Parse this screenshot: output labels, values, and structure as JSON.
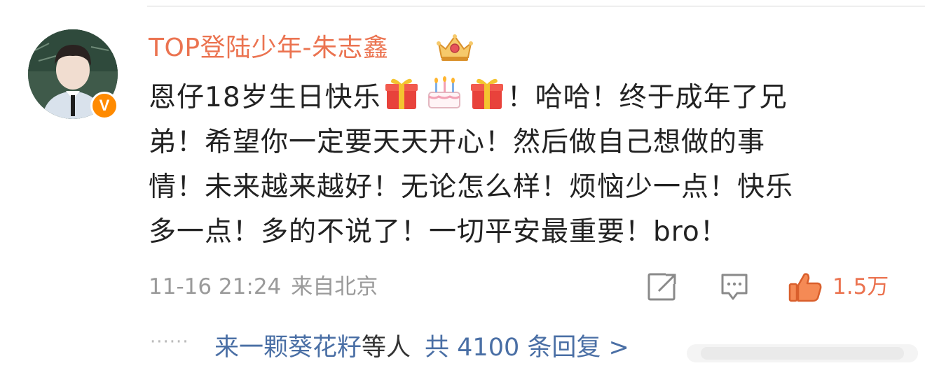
{
  "post": {
    "username": "TOP登陆少年-朱志鑫",
    "verified_badge": "V",
    "content_lines": [
      {
        "pre": "恩仔18岁生日快乐",
        "post": "！哈哈！终于成年了兄"
      },
      {
        "text": "弟！希望你一定要天天开心！然后做自己想做的事"
      },
      {
        "text": "情！未来越来越好！无论怎么样！烦恼少一点！快乐"
      },
      {
        "text": "多一点！多的不说了！一切平安最重要！bro！"
      }
    ],
    "emojis": [
      "gift-emoji",
      "cake-emoji",
      "gift-emoji"
    ],
    "date": "11-16 21:24",
    "location": "来自北京",
    "like_count": "1.5万"
  },
  "replies": {
    "user": "来一颗葵花籽",
    "others": "等人",
    "count_text": "共 4100 条回复 >"
  },
  "colors": {
    "username": "#eb7350",
    "link": "#4a6fa5",
    "meta": "#9a9a9a",
    "badge": "#ff8a00"
  }
}
